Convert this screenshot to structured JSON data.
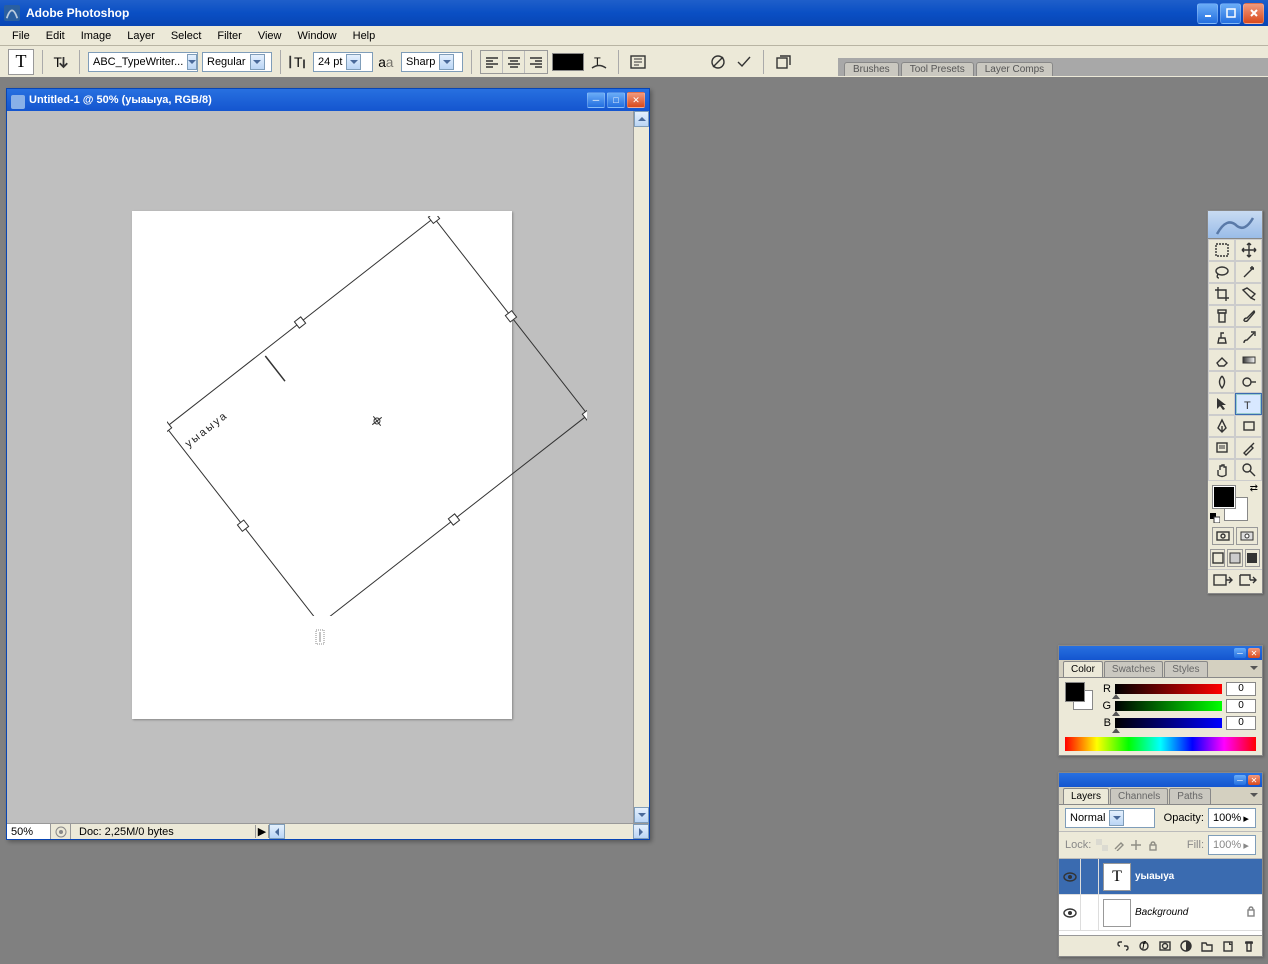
{
  "app": {
    "title": "Adobe Photoshop"
  },
  "menu": [
    "File",
    "Edit",
    "Image",
    "Layer",
    "Select",
    "Filter",
    "View",
    "Window",
    "Help"
  ],
  "options": {
    "font_family": "ABC_TypeWriter...",
    "font_style": "Regular",
    "font_size": "24 pt",
    "anti_alias": "Sharp"
  },
  "palette_well_tabs": [
    "Brushes",
    "Tool Presets",
    "Layer Comps"
  ],
  "document": {
    "title": "Untitled-1 @ 50% (уыаыуа, RGB/8)",
    "zoom": "50%",
    "status_info": "Doc: 2,25M/0 bytes",
    "canvas_text": "уыаыуа"
  },
  "color_panel": {
    "tabs": [
      "Color",
      "Swatches",
      "Styles"
    ],
    "channels": {
      "r_label": "R",
      "g_label": "G",
      "b_label": "B"
    },
    "values": {
      "r": "0",
      "g": "0",
      "b": "0"
    }
  },
  "layers_panel": {
    "tabs": [
      "Layers",
      "Channels",
      "Paths"
    ],
    "blend_mode": "Normal",
    "opacity_label": "Opacity:",
    "opacity_value": "100%",
    "lock_label": "Lock:",
    "fill_label": "Fill:",
    "fill_value": "100%",
    "layers": [
      {
        "name": "уыаыуа",
        "type": "text",
        "selected": true,
        "visible": true
      },
      {
        "name": "Background",
        "type": "bg",
        "selected": false,
        "visible": true,
        "locked": true
      }
    ]
  }
}
